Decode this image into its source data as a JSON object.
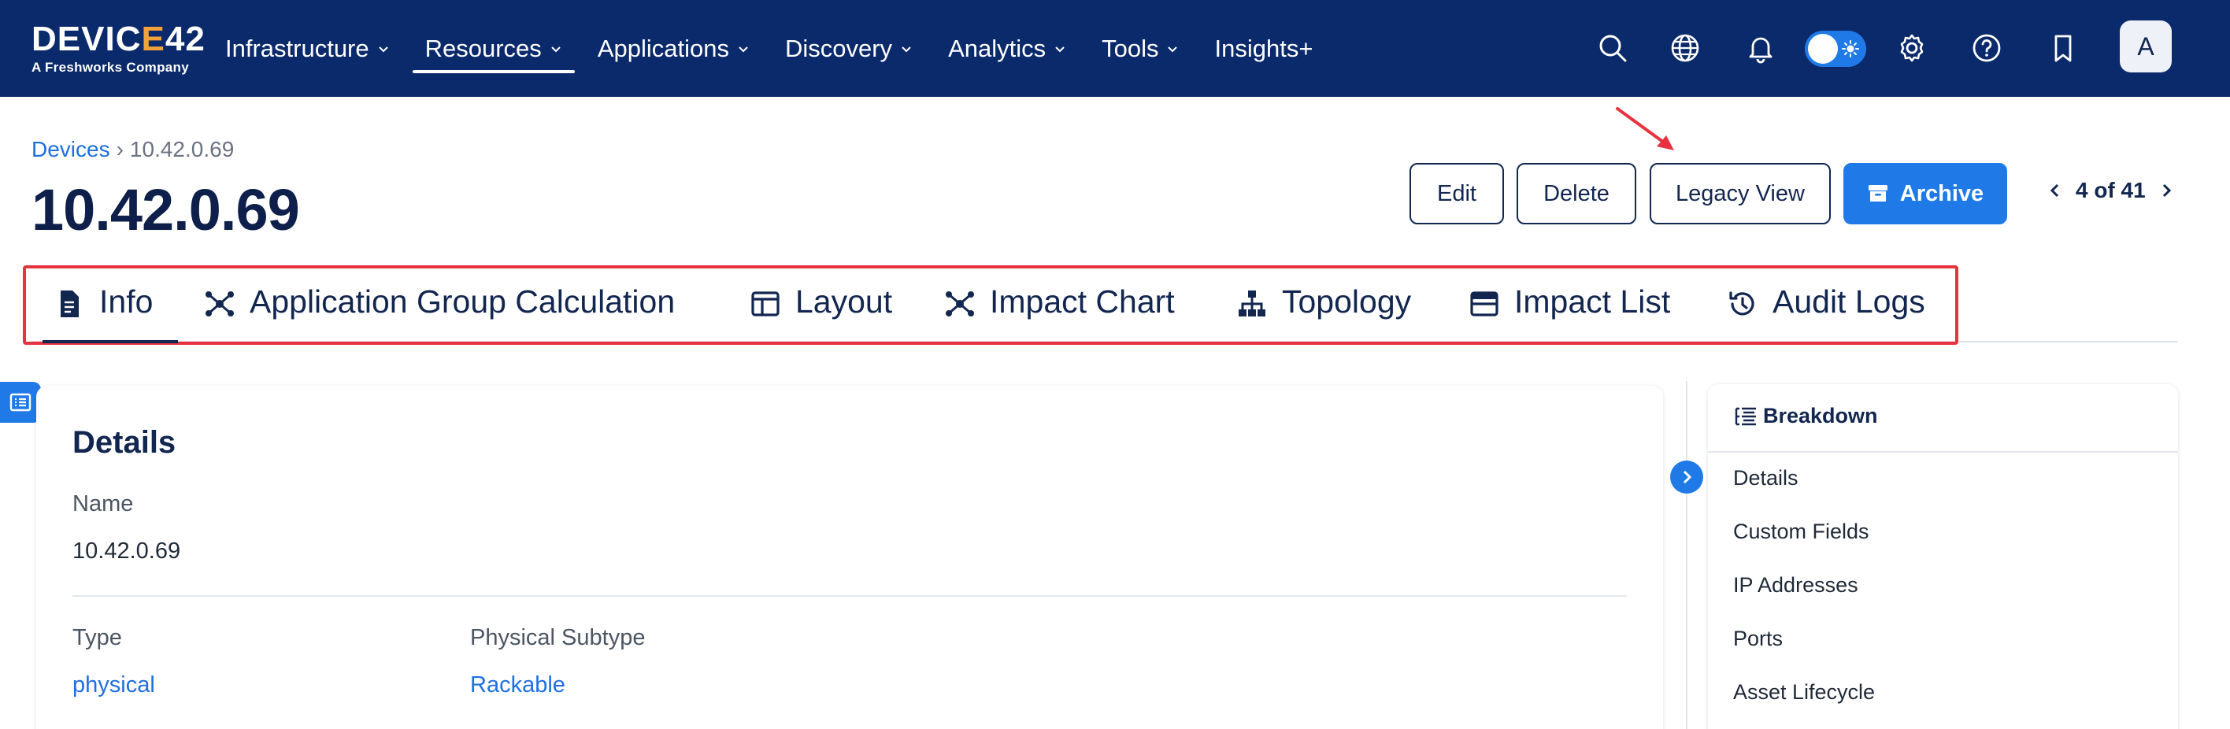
{
  "brand": {
    "logo_prefix": "DEVIC",
    "logo_highlight": "E",
    "logo_suffix": "42",
    "tagline": "A Freshworks Company"
  },
  "nav": {
    "items": [
      {
        "label": "Infrastructure",
        "dropdown": true
      },
      {
        "label": "Resources",
        "dropdown": true,
        "active": true
      },
      {
        "label": "Applications",
        "dropdown": true
      },
      {
        "label": "Discovery",
        "dropdown": true
      },
      {
        "label": "Analytics",
        "dropdown": true
      },
      {
        "label": "Tools",
        "dropdown": true
      },
      {
        "label": "Insights+",
        "dropdown": false
      }
    ],
    "icons": [
      "search-icon",
      "globe-icon",
      "bell-icon",
      "theme-toggle",
      "gear-icon",
      "help-icon",
      "bookmark-icon"
    ],
    "avatar_initial": "A"
  },
  "breadcrumb": {
    "root": "Devices",
    "separator": "›",
    "current": "10.42.0.69"
  },
  "page": {
    "title": "10.42.0.69"
  },
  "actions": {
    "edit": "Edit",
    "delete": "Delete",
    "legacy_view": "Legacy View",
    "archive": "Archive"
  },
  "pager": {
    "text": "4 of 41"
  },
  "tabs": [
    {
      "label": "Info",
      "icon": "document-icon",
      "active": true
    },
    {
      "label": "Application Group Calculation",
      "icon": "network-icon"
    },
    {
      "label": "Layout",
      "icon": "layout-icon"
    },
    {
      "label": "Impact Chart",
      "icon": "network-icon"
    },
    {
      "label": "Topology",
      "icon": "hierarchy-icon"
    },
    {
      "label": "Impact List",
      "icon": "list-box-icon"
    },
    {
      "label": "Audit Logs",
      "icon": "history-icon"
    }
  ],
  "details": {
    "heading": "Details",
    "name_label": "Name",
    "name_value": "10.42.0.69",
    "type_label": "Type",
    "type_value": "physical",
    "subtype_label": "Physical Subtype",
    "subtype_value": "Rackable"
  },
  "breakdown": {
    "title": "Breakdown",
    "items": [
      "Details",
      "Custom Fields",
      "IP Addresses",
      "Ports",
      "Asset Lifecycle"
    ]
  },
  "colors": {
    "nav_bg": "#0b2a6b",
    "accent": "#1f7ae8",
    "link": "#1f6fe0",
    "highlight_outline": "#e8323f",
    "logo_accent": "#f2a23a"
  }
}
